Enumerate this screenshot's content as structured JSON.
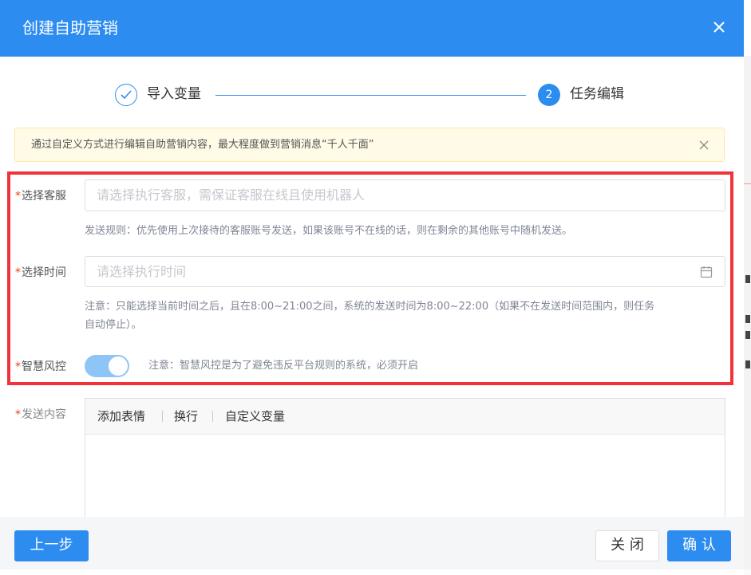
{
  "dialog": {
    "title": "创建自助营销"
  },
  "steps": [
    {
      "number": "1",
      "label": "导入变量",
      "status": "finished"
    },
    {
      "number": "2",
      "label": "任务编辑",
      "status": "current"
    }
  ],
  "alert": {
    "text": "通过自定义方式进行编辑自助营销内容，最大程度做到营销消息“千人千面”"
  },
  "form": {
    "agent": {
      "required_mark": "*",
      "label": "选择客服",
      "placeholder": "请选择执行客服，需保证客服在线且使用机器人",
      "hint": "发送规则：优先使用上次接待的客服账号发送，如果该账号不在线的话，则在剩余的其他账号中随机发送。"
    },
    "time": {
      "required_mark": "*",
      "label": "选择时间",
      "placeholder": "请选择执行时间",
      "hint_line1": "注意：只能选择当前时间之后，且在8:00~21:00之间，系统的发送时间为8:00~22:00（如果不在发送时间范围内，则任务",
      "hint_line2": "自动停止）。"
    },
    "risk_control": {
      "required_mark": "*",
      "label": "智慧风控",
      "enabled": true,
      "hint": "注意：智慧风控是为了避免违反平台规则的系统，必须开启"
    },
    "content": {
      "required_mark": "*",
      "label": "发送内容",
      "toolbar": [
        "添加表情",
        "换行",
        "自定义变量"
      ]
    }
  },
  "footer": {
    "prev_label": "上一步",
    "close_label": "关 闭",
    "confirm_label": "确 认"
  },
  "colors": {
    "primary": "#2d8cf0",
    "highlight_border": "#f0333b",
    "switch_on": "#8ec5f7",
    "alert_bg": "#fffbe6"
  }
}
